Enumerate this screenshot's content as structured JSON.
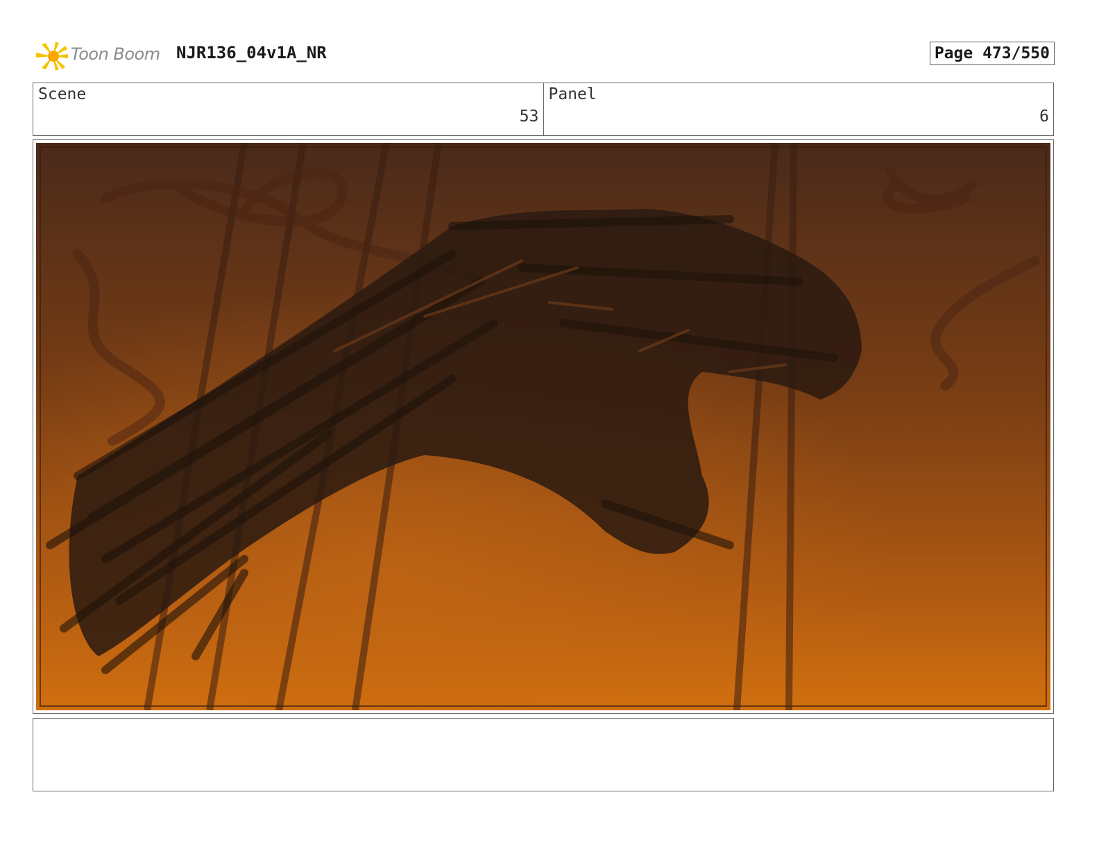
{
  "header": {
    "logo_text": "Toon Boom",
    "title": "NJR136_04v1A_NR",
    "page_label": "Page 473/550"
  },
  "info": {
    "scene_label": "Scene",
    "scene_value": "53",
    "panel_label": "Panel",
    "panel_value": "6"
  },
  "panel_image": {
    "description_icon": "storyboard-panel-art",
    "colors": {
      "top": "#4a2a1a",
      "mid": "#7a3e14",
      "bottom": "#d2700e",
      "silhouette": "#2a1a10"
    }
  },
  "notes": {
    "text": ""
  }
}
